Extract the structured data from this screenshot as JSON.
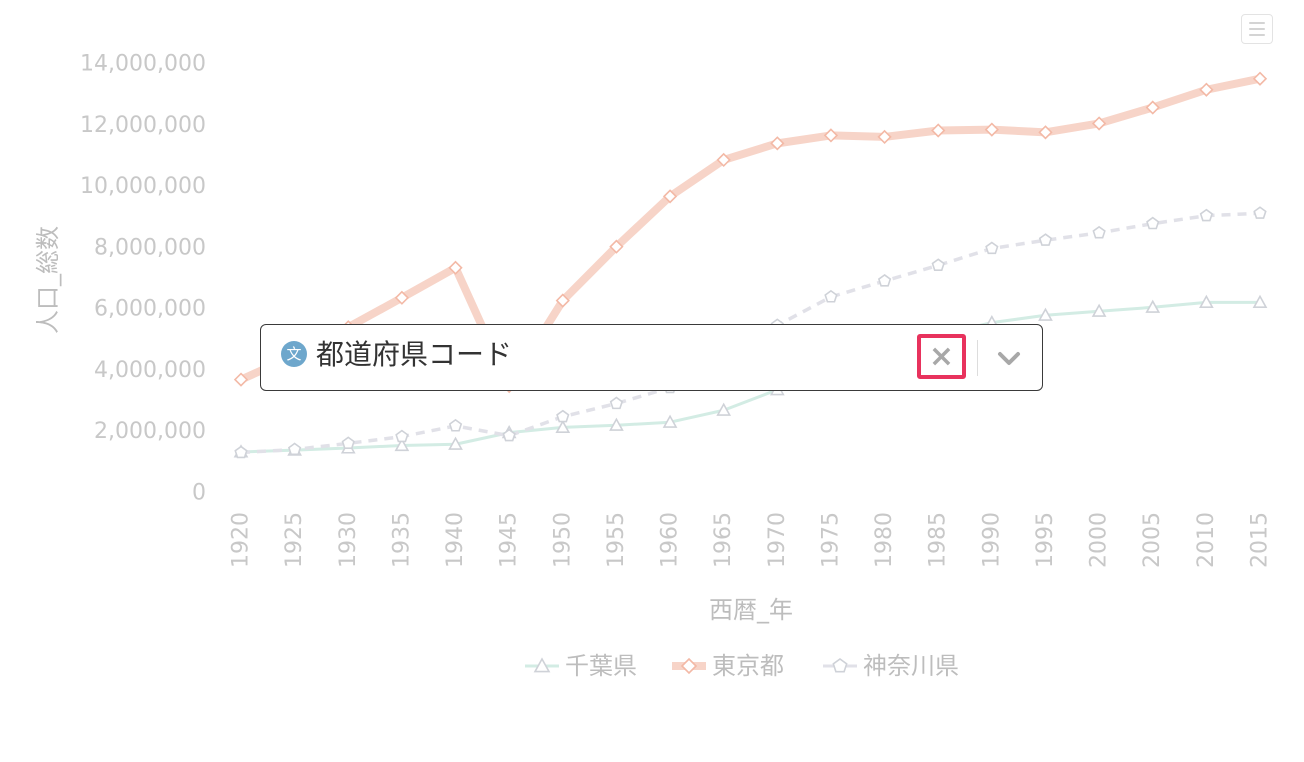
{
  "chart_data": {
    "type": "line",
    "xlabel": "西暦_年",
    "ylabel": "人口_総数",
    "ylim": [
      0,
      14000000
    ],
    "yticks": [
      "0",
      "2,000,000",
      "4,000,000",
      "6,000,000",
      "8,000,000",
      "10,000,000",
      "12,000,000",
      "14,000,000"
    ],
    "categories": [
      "1920",
      "1925",
      "1930",
      "1935",
      "1940",
      "1945",
      "1950",
      "1955",
      "1960",
      "1965",
      "1970",
      "1975",
      "1980",
      "1985",
      "1990",
      "1995",
      "2000",
      "2005",
      "2010",
      "2015"
    ],
    "legend_position": "bottom",
    "series": [
      {
        "name": "千葉県",
        "color": "#d3ece4",
        "marker": "triangle",
        "style": "solid-thin",
        "values": [
          1340000,
          1400000,
          1470000,
          1550000,
          1590000,
          1970000,
          2140000,
          2210000,
          2310000,
          2700000,
          3370000,
          4150000,
          4740000,
          5150000,
          5560000,
          5800000,
          5930000,
          6060000,
          6220000,
          6220000
        ]
      },
      {
        "name": "東京都",
        "color": "#f7d4c8",
        "marker": "diamond",
        "style": "solid-thick",
        "values": [
          3700000,
          4490000,
          5410000,
          6370000,
          7350000,
          3490000,
          6280000,
          8040000,
          9680000,
          10870000,
          11410000,
          11670000,
          11620000,
          11830000,
          11860000,
          11770000,
          12060000,
          12580000,
          13160000,
          13520000
        ]
      },
      {
        "name": "神奈川県",
        "color": "#e1e1e8",
        "marker": "pentagon",
        "style": "dashed",
        "values": [
          1320000,
          1420000,
          1620000,
          1840000,
          2190000,
          1870000,
          2490000,
          2920000,
          3440000,
          4430000,
          5470000,
          6400000,
          6920000,
          7430000,
          7980000,
          8250000,
          8490000,
          8790000,
          9050000,
          9130000
        ]
      }
    ]
  },
  "select": {
    "type_badge": "文",
    "value": "都道府県コード",
    "clear_symbol": "×"
  }
}
